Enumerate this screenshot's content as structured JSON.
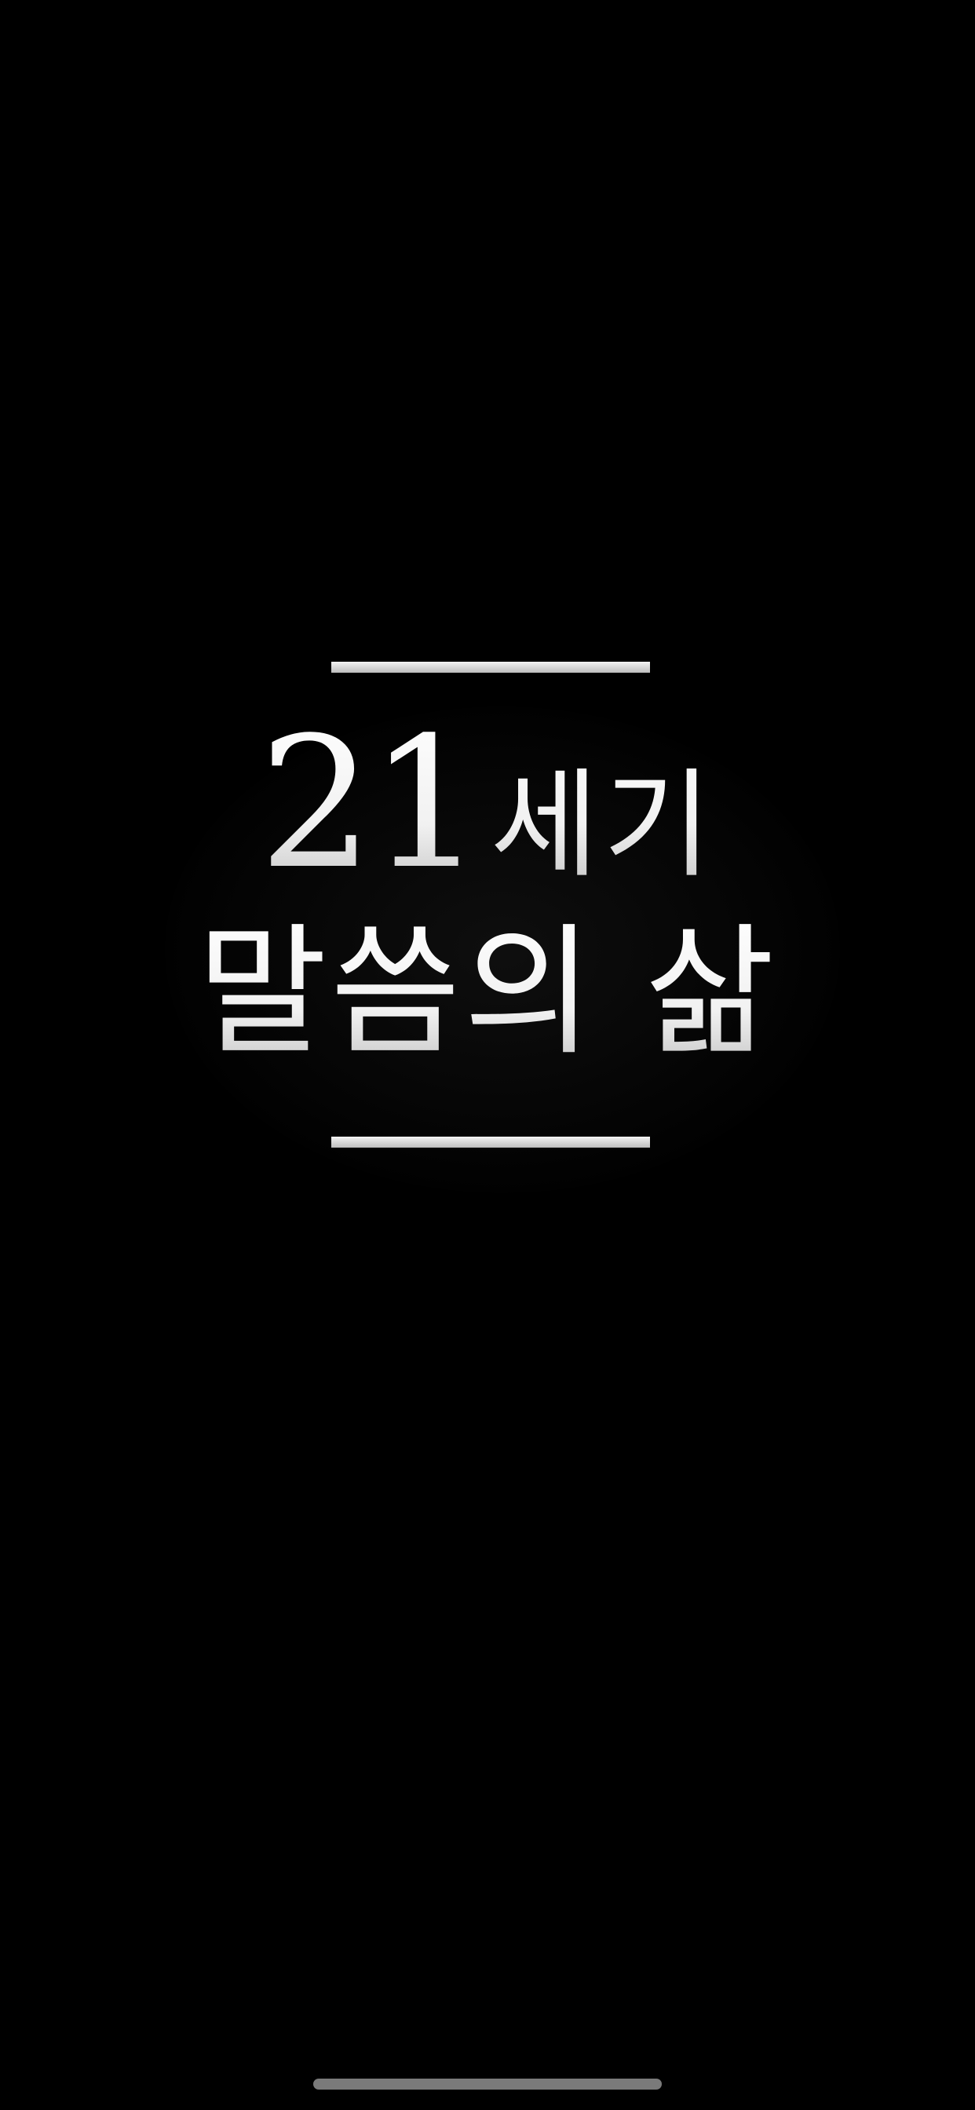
{
  "splash": {
    "title_number": "21",
    "title_word": "세기",
    "subtitle": "말씀의 삶"
  },
  "colors": {
    "background": "#000000",
    "text": "#ffffff",
    "rule": "#e6e6e6",
    "home_indicator": "#7a7a7a"
  }
}
